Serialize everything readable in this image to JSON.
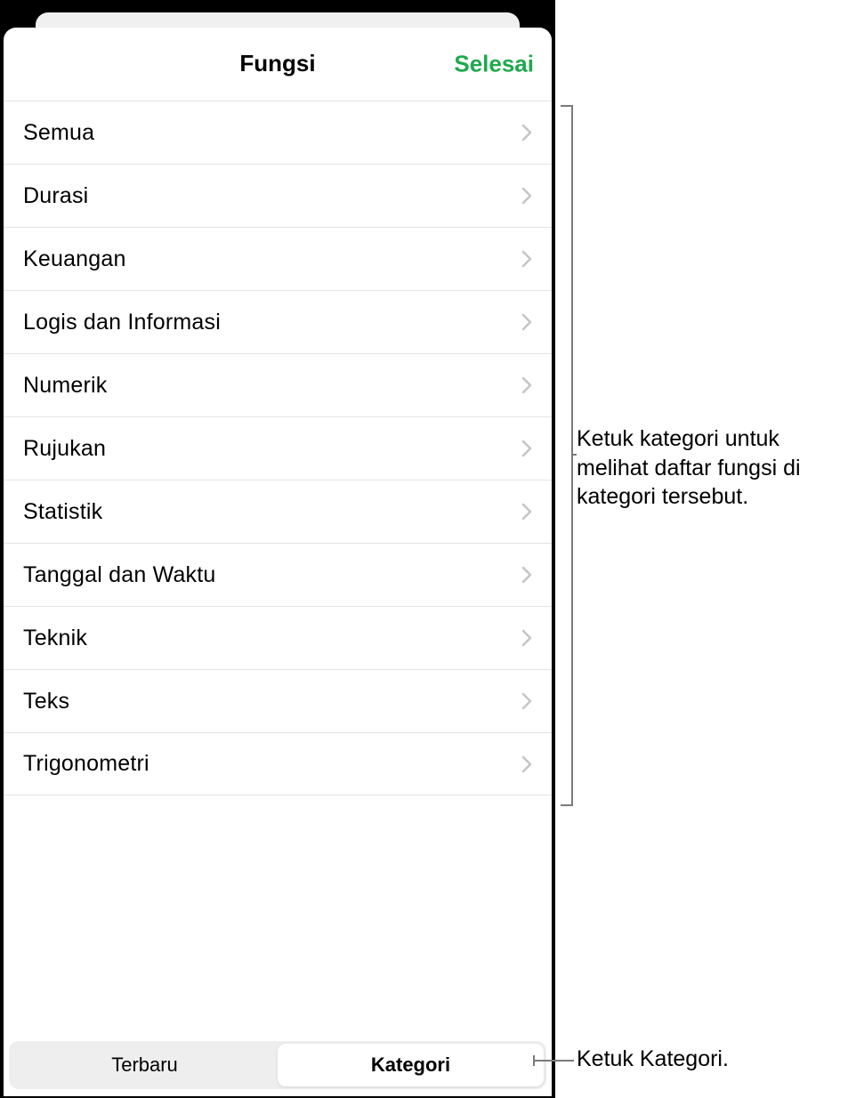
{
  "header": {
    "title": "Fungsi",
    "done_label": "Selesai"
  },
  "categories": [
    {
      "label": "Semua"
    },
    {
      "label": "Durasi"
    },
    {
      "label": "Keuangan"
    },
    {
      "label": "Logis dan Informasi"
    },
    {
      "label": "Numerik"
    },
    {
      "label": "Rujukan"
    },
    {
      "label": "Statistik"
    },
    {
      "label": "Tanggal dan Waktu"
    },
    {
      "label": "Teknik"
    },
    {
      "label": "Teks"
    },
    {
      "label": "Trigonometri"
    }
  ],
  "tabs": {
    "recent_label": "Terbaru",
    "category_label": "Kategori",
    "selected": "category"
  },
  "callouts": {
    "list_hint": "Ketuk kategori untuk melihat daftar fungsi di kategori tersebut.",
    "tab_hint": "Ketuk Kategori."
  },
  "colors": {
    "accent": "#1fa94d",
    "chevron": "#c5c5c7",
    "separator": "#e3e3e5",
    "segment_bg": "#eeeeef"
  }
}
